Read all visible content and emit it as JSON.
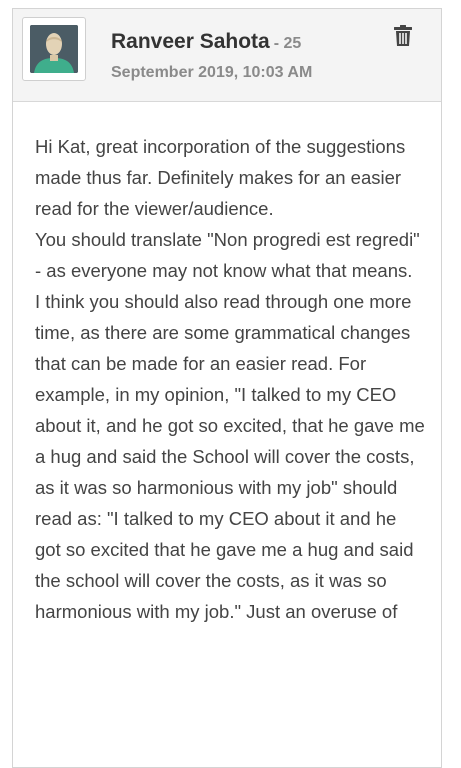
{
  "comment": {
    "author_name": "Ranveer Sahota",
    "author_count": "- 25",
    "timestamp": "September 2019, 10:03 AM",
    "avatar_icon": "user-silhouette-icon",
    "delete_icon": "trash-icon",
    "paragraphs": [
      "Hi Kat, great incorporation of the suggestions made thus far. Definitely makes for an easier read for the viewer/audience.",
      "You should translate \"Non progredi est regredi\" - as everyone may not know what that means.",
      "I think you should also read through one more time, as there are some grammatical changes that can be made for an easier read. For example, in my opinion, \"I talked to my CEO about it, and he got so excited, that he gave me a hug and said the School will cover the costs, as it was so harmonious with my job\" should read as: \"I talked to my CEO about it and he got so excited that he gave me a hug and said the school will cover the costs, as it was so harmonious with my job.\" Just an overuse of"
    ]
  }
}
